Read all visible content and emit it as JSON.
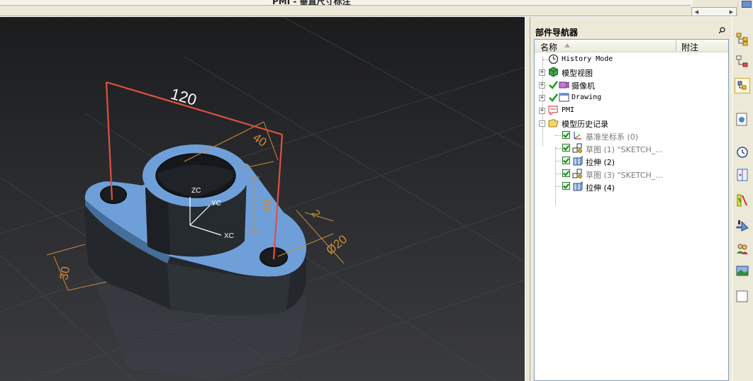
{
  "topbar": {
    "title": "PMI - 垂直尺寸标注"
  },
  "navigator": {
    "title": "部件导航器",
    "columns": {
      "name": "名称",
      "notes": "附注"
    },
    "items": [
      {
        "label": "History Mode",
        "icon": "history-clock-icon",
        "level": 0,
        "expander": "",
        "check": "none",
        "mono": true
      },
      {
        "label": "模型视图",
        "icon": "model-views-icon",
        "level": 0,
        "expander": "+",
        "check": "none",
        "mono": false
      },
      {
        "label": "摄像机",
        "icon": "camera-icon",
        "level": 0,
        "expander": "+",
        "check": "green-tick",
        "mono": false
      },
      {
        "label": "Drawing",
        "icon": "drawing-sheet-icon",
        "level": 0,
        "expander": "+",
        "check": "green-tick",
        "mono": true
      },
      {
        "label": "PMI",
        "icon": "pmi-icon",
        "level": 0,
        "expander": "+",
        "check": "none",
        "mono": true
      },
      {
        "label": "模型历史记录",
        "icon": "folder-open-icon",
        "level": 0,
        "expander": "-",
        "check": "none",
        "mono": false
      },
      {
        "label": "基准坐标系 (0)",
        "icon": "datum-csys-icon",
        "level": 1,
        "expander": "",
        "check": "checkbox",
        "mono": false,
        "dim": true
      },
      {
        "label": "草图 (1) \"SKETCH_...",
        "icon": "sketch-icon",
        "level": 1,
        "expander": "",
        "check": "checkbox",
        "mono": false,
        "dim": true
      },
      {
        "label": "拉伸 (2)",
        "icon": "extrude-icon",
        "level": 1,
        "expander": "",
        "check": "checkbox",
        "mono": false,
        "dim": false
      },
      {
        "label": "草图 (3) \"SKETCH_...",
        "icon": "sketch-icon",
        "level": 1,
        "expander": "",
        "check": "checkbox",
        "mono": false,
        "dim": true
      },
      {
        "label": "拉伸 (4)",
        "icon": "extrude-icon",
        "level": 1,
        "expander": "",
        "check": "checkbox",
        "mono": false,
        "dim": false
      }
    ]
  },
  "viewport": {
    "dimensions": {
      "d120": "120",
      "d40a": "40",
      "d40b": "40",
      "d30": "30",
      "d2": "2",
      "dphi": "Ø20"
    },
    "axes": {
      "zc": "ZC",
      "yc": "YC",
      "xc": "XC"
    }
  },
  "right_toolbar": {
    "icons": [
      "assembly-navigator-icon",
      "constraint-navigator-icon",
      "part-navigator-icon",
      "reuse-library-icon",
      "history-icon",
      "system-materials-icon",
      "process-studio-icon",
      "manufacturing-wizard-icon",
      "roles-icon",
      "system-scenes-icon",
      "blank-icon"
    ]
  },
  "colors": {
    "pmi_red": "#e05040",
    "dimension_orange": "#c98a3a",
    "face_blue": "#6f9fd8",
    "body_dark": "#2b2f33"
  }
}
